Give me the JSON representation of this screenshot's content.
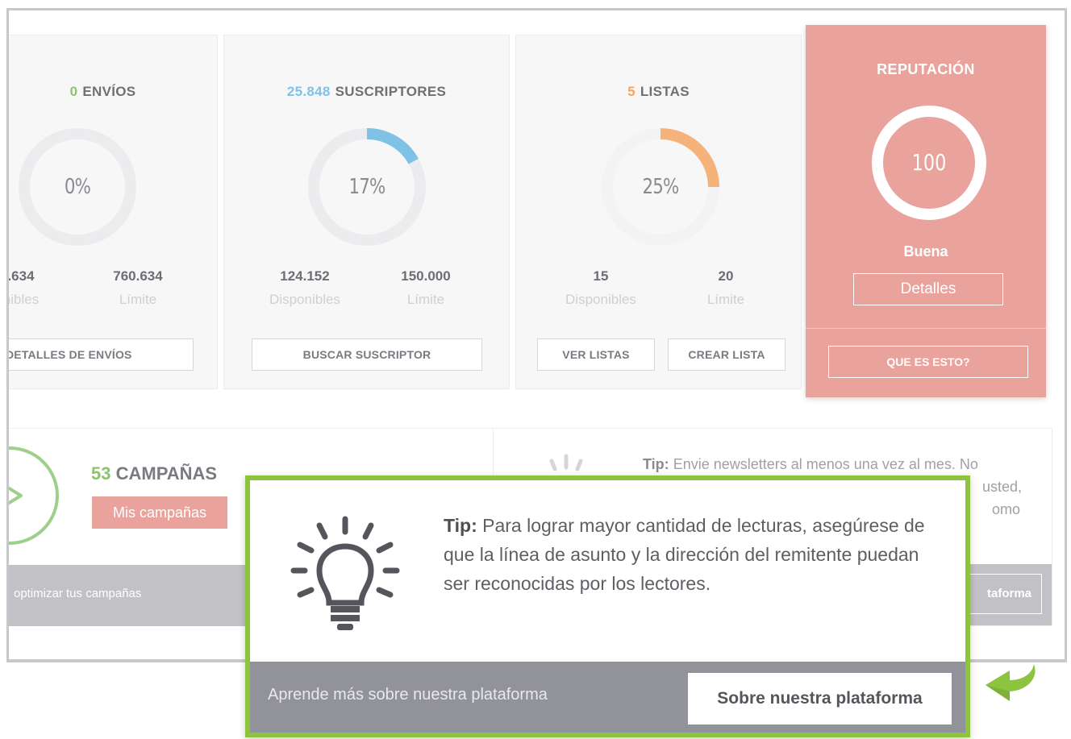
{
  "envios": {
    "count": "0",
    "title": "ENVÍOS",
    "percent": 0,
    "percent_label": "0%",
    "disponibles_value": ".634",
    "disponibles_label": "nibles",
    "limite_value": "760.634",
    "limite_label": "Límite",
    "button": "DETALLES DE ENVÍOS",
    "color": "#8cc46c"
  },
  "suscriptores": {
    "count": "25.848",
    "title": "SUSCRIPTORES",
    "percent": 17,
    "percent_label": "17%",
    "disponibles_value": "124.152",
    "disponibles_label": "Disponibles",
    "limite_value": "150.000",
    "limite_label": "Límite",
    "button": "BUSCAR SUSCRIPTOR",
    "color": "#7ec3e6"
  },
  "listas": {
    "count": "5",
    "title": "LISTAS",
    "percent": 25,
    "percent_label": "25%",
    "disponibles_value": "15",
    "disponibles_label": "Disponibles",
    "limite_value": "20",
    "limite_label": "Límite",
    "button_view": "VER LISTAS",
    "button_create": "CREAR LISTA",
    "color": "#f5b27b"
  },
  "reputacion": {
    "title": "REPUTACIÓN",
    "score": "100",
    "status": "Buena",
    "details_button": "Detalles",
    "what_button": "QUE ES ESTO?",
    "color": "#e9a39c"
  },
  "campaigns": {
    "count": "53",
    "title": "CAMPAÑAS",
    "button": "Mis campañas",
    "footer": "optimizar tus campañas"
  },
  "tip_background": {
    "bold": "Tip:",
    "text": "Envie newsletters al menos una vez al mes. No",
    "line2": "usted,",
    "line3": "omo",
    "footer_button": "taforma"
  },
  "tip_highlight": {
    "bold": "Tip:",
    "text": "Para lograr mayor cantidad de lecturas, asegúrese de que la línea de asunto y la dirección del remitente puedan ser reconocidas por los lectores.",
    "footer_text": "Aprende más sobre nuestra plataforma",
    "footer_button": "Sobre nuestra plataforma"
  },
  "colors": {
    "highlight_border": "#8cc43f",
    "footer_gray": "#91929a",
    "arrow": "#8cc43f"
  }
}
